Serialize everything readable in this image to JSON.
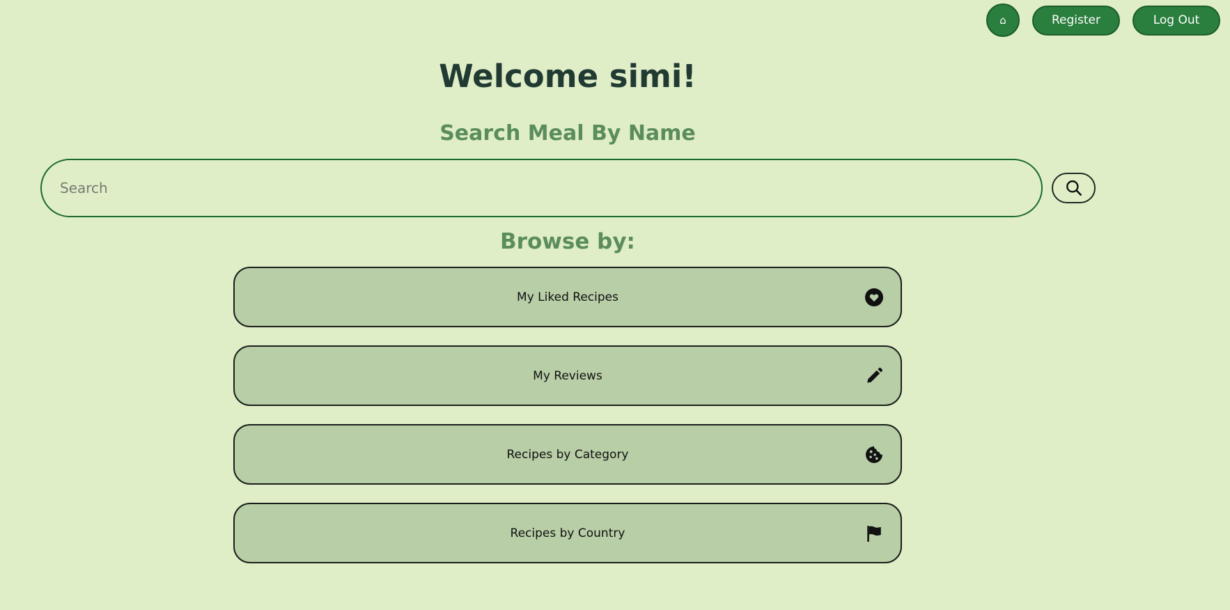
{
  "nav": {
    "home_icon": "⌂",
    "home_icon_name": "home-icon",
    "register_label": "Register",
    "logout_label": "Log Out"
  },
  "main": {
    "welcome": "Welcome simi!",
    "search_heading": "Search Meal By Name",
    "search_placeholder": "Search",
    "search_value": "",
    "search_button_icon": "search-icon",
    "browse_heading": "Browse by:"
  },
  "browse": {
    "items": [
      {
        "label": "My Liked Recipes",
        "icon": "heart-icon"
      },
      {
        "label": "My Reviews",
        "icon": "pencil-icon"
      },
      {
        "label": "Recipes by Category",
        "icon": "cookie-icon"
      },
      {
        "label": "Recipes by Country",
        "icon": "flag-icon"
      }
    ]
  },
  "colors": {
    "background": "#e0eec8",
    "nav_button": "#2a7e3e",
    "heading_dark": "#213b33",
    "heading_green": "#5b8d5c",
    "card": "#b8cea6"
  }
}
